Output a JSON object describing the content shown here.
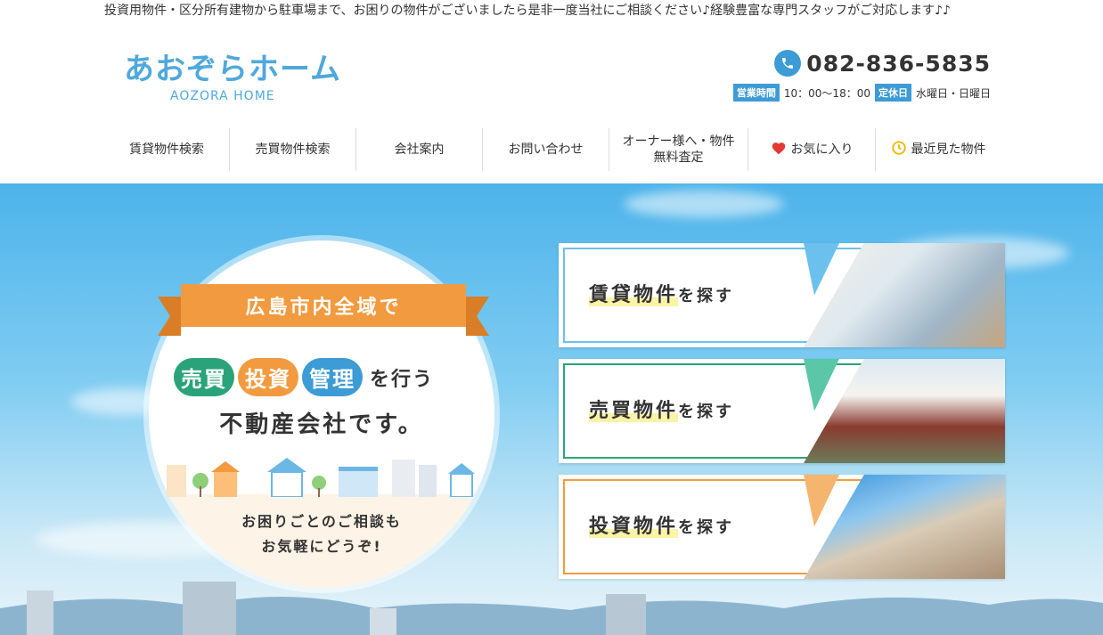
{
  "top_note": "投資用物件・区分所有建物から駐車場まで、お困りの物件がございましたら是非一度当社にご相談ください♪経験豊富な専門スタッフがご対応します♪♪",
  "logo": {
    "main": "あおぞらホーム",
    "sub": "AOZORA HOME"
  },
  "contact": {
    "phone": "082-836-5835",
    "hours_tag": "営業時間",
    "hours": "10：00〜18：00",
    "closed_tag": "定休日",
    "closed": "水曜日・日曜日"
  },
  "nav": [
    {
      "label": "賃貸物件検索"
    },
    {
      "label": "売買物件検索"
    },
    {
      "label": "会社案内"
    },
    {
      "label": "お問い合わせ"
    },
    {
      "label": "オーナー様へ・物件\n無料査定"
    },
    {
      "label": "お気に入り",
      "icon": "heart-icon"
    },
    {
      "label": "最近見た物件",
      "icon": "history-icon"
    }
  ],
  "hero": {
    "ribbon": "広島市内全域で",
    "pills": [
      "売買",
      "投資",
      "管理"
    ],
    "pill_suffix": "を行う",
    "tagline": "不動産会社です。",
    "consult_1": "お困りごとのご相談も",
    "consult_2": "お気軽にどうぞ!"
  },
  "cards": [
    {
      "main": "賃貸物件",
      "suffix": "を探す",
      "color": "#6cc0ee",
      "photo": "interior-photo"
    },
    {
      "main": "売買物件",
      "suffix": "を探す",
      "color": "#2aa37a",
      "photo": "house-photo"
    },
    {
      "main": "投資物件",
      "suffix": "を探す",
      "color": "#f29a3f",
      "photo": "building-photo"
    }
  ],
  "colors": {
    "accent_blue": "#3d9bd6",
    "accent_orange": "#f29a3f",
    "accent_green": "#2aa37a"
  }
}
